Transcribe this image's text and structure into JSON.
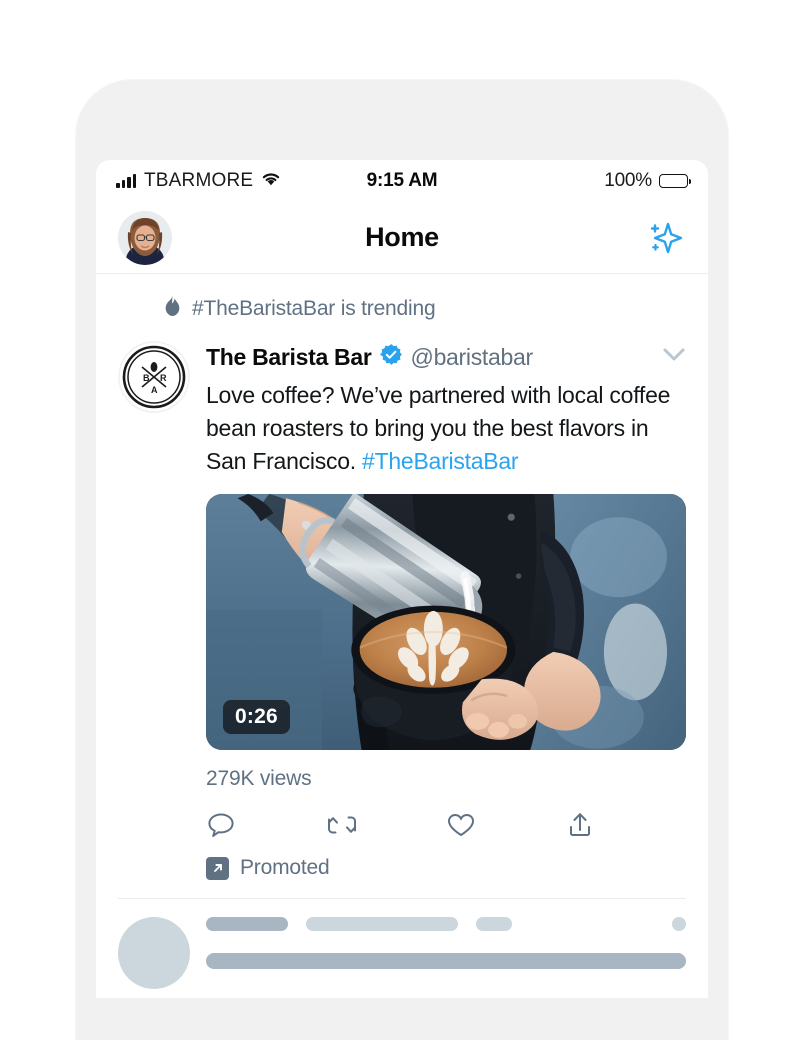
{
  "status_bar": {
    "carrier": "TBARMORE",
    "time": "9:15 AM",
    "battery_percent": "100%",
    "signal_icon": "signal-bars-icon",
    "wifi_icon": "wifi-icon",
    "battery_icon": "battery-full-icon"
  },
  "header": {
    "title": "Home",
    "avatar_name": "user-avatar",
    "sparkle_icon": "sparkle-icon"
  },
  "trending": {
    "icon": "flame-icon",
    "text": "#TheBaristaBar is trending"
  },
  "tweet": {
    "avatar_icon": "barista-bar-logo",
    "author": "The Barista Bar",
    "verified_icon": "verified-badge-icon",
    "handle": "@baristabar",
    "caret_icon": "chevron-down-icon",
    "text_line_1": "Love coffee? We’ve partnered with local",
    "text_line_2": "coffee bean roasters to bring you the",
    "text_line_3": "best flavors in San Francisco.",
    "hashtag": "#TheBaristaBar",
    "media": {
      "type": "video",
      "duration": "0:26",
      "description": "barista-pouring-latte-art",
      "views": "279K views"
    },
    "actions": [
      {
        "name": "reply-button",
        "icon": "reply-icon"
      },
      {
        "name": "retweet-button",
        "icon": "retweet-icon"
      },
      {
        "name": "like-button",
        "icon": "heart-icon"
      },
      {
        "name": "share-button",
        "icon": "share-icon"
      }
    ],
    "promoted": {
      "badge_icon": "promoted-arrow-icon",
      "label": "Promoted"
    }
  },
  "next_tweet_skeleton": {
    "avatar": "skeleton-avatar",
    "bars": [
      "name",
      "handle",
      "timestamp",
      "more"
    ]
  },
  "colors": {
    "twitter_blue": "#2aa3ef",
    "text_primary": "#13171a",
    "text_secondary": "#5f7183",
    "skeleton_dark": "#a7b6c2",
    "skeleton_light": "#ccd6dd",
    "frame": "#f1f1f1"
  }
}
